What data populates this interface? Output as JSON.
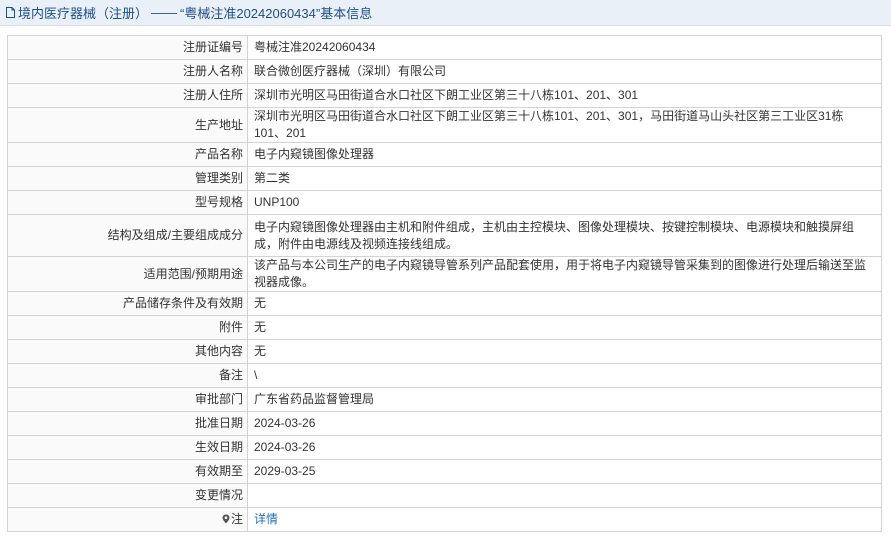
{
  "header": {
    "icon": "document-icon",
    "category": "境内医疗器械（注册）",
    "separator": "——",
    "subject": "“粤械注准20242060434”基本信息"
  },
  "fields": [
    {
      "label": "注册证编号",
      "value": "粤械注准20242060434"
    },
    {
      "label": "注册人名称",
      "value": "联合微创医疗器械（深圳）有限公司"
    },
    {
      "label": "注册人住所",
      "value": "深圳市光明区马田街道合水口社区下朗工业区第三十八栋101、201、301"
    },
    {
      "label": "生产地址",
      "value": "深圳市光明区马田街道合水口社区下朗工业区第三十八栋101、201、301，马田街道马山头社区第三工业区31栋101、201"
    },
    {
      "label": "产品名称",
      "value": "电子内窥镜图像处理器"
    },
    {
      "label": "管理类别",
      "value": "第二类"
    },
    {
      "label": "型号规格",
      "value": "UNP100"
    },
    {
      "label": "结构及组成/主要组成成分",
      "value": "电子内窥镜图像处理器由主机和附件组成，主机由主控模块、图像处理模块、按键控制模块、电源模块和触摸屏组成，附件由电源线及视频连接线组成。"
    },
    {
      "label": "适用范围/预期用途",
      "value": "该产品与本公司生产的电子内窥镜导管系列产品配套使用，用于将电子内窥镜导管采集到的图像进行处理后输送至监视器成像。"
    },
    {
      "label": "产品储存条件及有效期",
      "value": "无"
    },
    {
      "label": "附件",
      "value": "无"
    },
    {
      "label": "其他内容",
      "value": "无"
    },
    {
      "label": "备注",
      "value": "\\"
    },
    {
      "label": "审批部门",
      "value": "广东省药品监督管理局"
    },
    {
      "label": "批准日期",
      "value": "2024-03-26"
    },
    {
      "label": "生效日期",
      "value": "2024-03-26"
    },
    {
      "label": "有效期至",
      "value": "2029-03-25"
    },
    {
      "label": "变更情况",
      "value": ""
    }
  ],
  "note_row": {
    "icon": "pin-icon",
    "label": "注",
    "link_text": "详情"
  },
  "colors": {
    "title_text": "#1f4e8c",
    "title_bg": "#eaf0f7",
    "link": "#1e6fbf",
    "border": "#d3d3d3"
  }
}
